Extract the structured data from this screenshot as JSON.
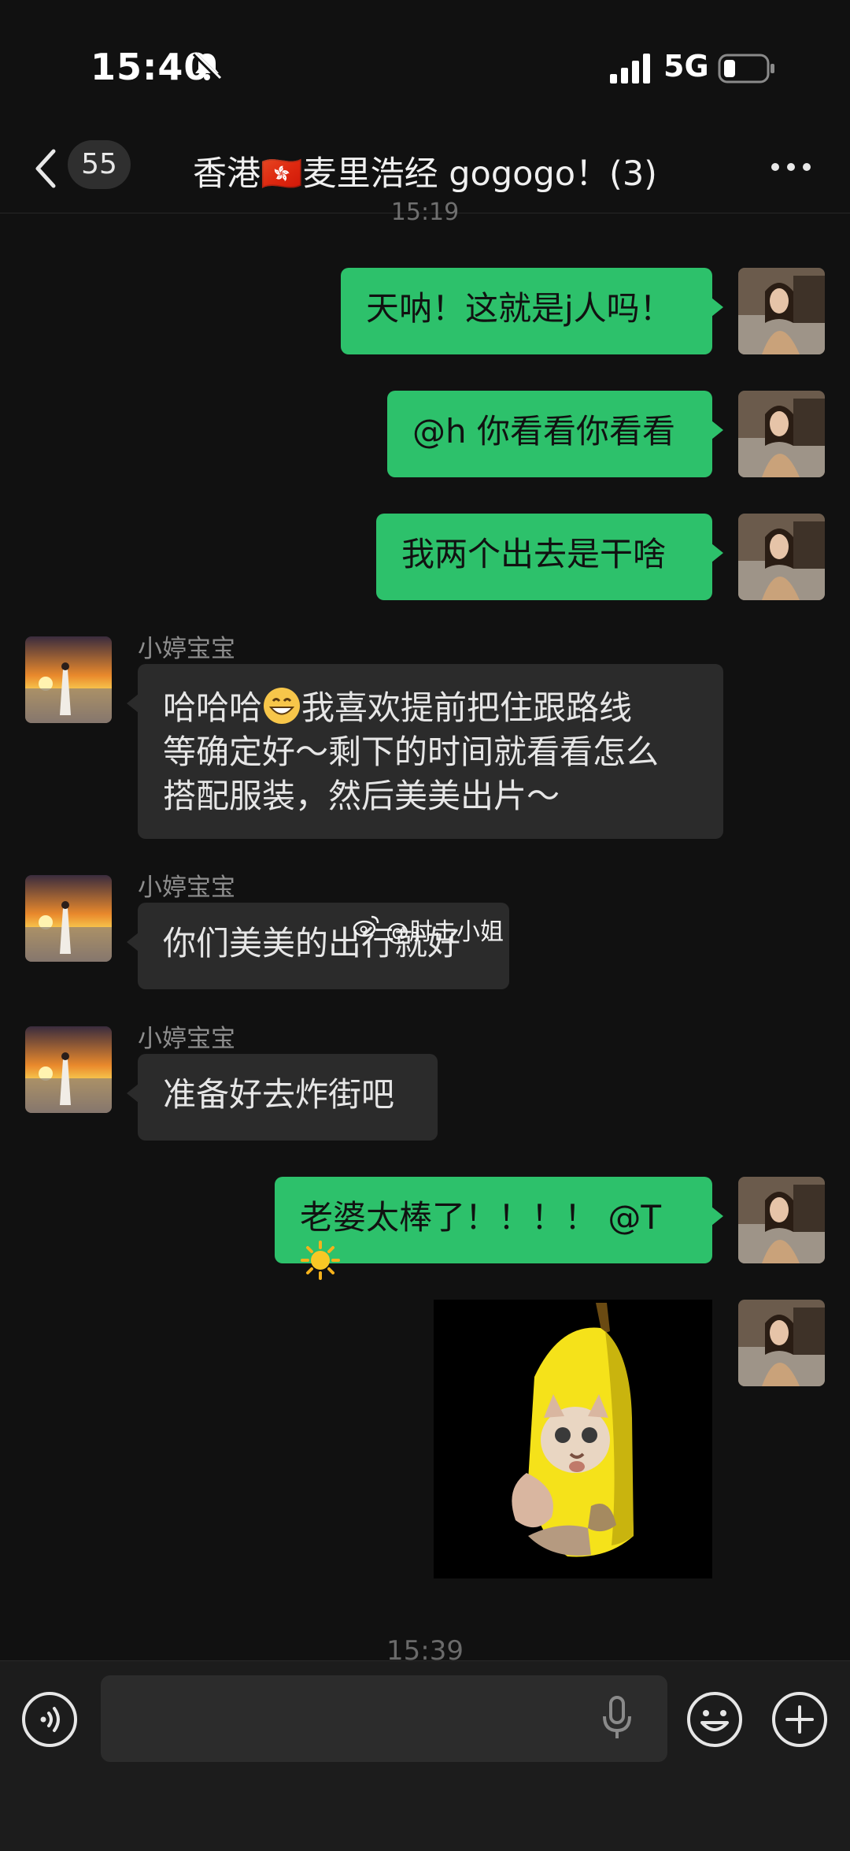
{
  "status_bar": {
    "time": "15:40",
    "network": "5G",
    "icons": [
      "mute-bell-icon",
      "signal-bars-icon",
      "battery-icon"
    ]
  },
  "header": {
    "unread_count": "55",
    "title": "香港🇭🇰麦里浩经 gogogo！(3)",
    "icons": [
      "back-chevron-icon",
      "more-dots-icon"
    ]
  },
  "timestamps": {
    "top": "15:19",
    "bottom": "15:39"
  },
  "messages": [
    {
      "from": "me",
      "text": "天呐！这就是j人吗！"
    },
    {
      "from": "me",
      "text": "@h 你看看你看看"
    },
    {
      "from": "me",
      "text": "我两个出去是干啥"
    },
    {
      "from": "other",
      "sender": "小婷宝宝",
      "lines": [
        "哈哈哈",
        "我喜欢提前把住跟路线",
        "等确定好～剩下的时间就看看怎么",
        "搭配服装，然后美美出片～"
      ]
    },
    {
      "from": "other",
      "sender": "小婷宝宝",
      "text": "你们美美的出行就好"
    },
    {
      "from": "other",
      "sender": "小婷宝宝",
      "text": "准备好去炸街吧"
    },
    {
      "from": "me",
      "text": "老婆太棒了！！！！ @T"
    },
    {
      "from": "me",
      "type": "sticker",
      "sticker": "banana-cat-sticker"
    }
  ],
  "watermark": "@肘击小姐",
  "input_bar": {
    "value": "",
    "icons": [
      "voice-icon",
      "microphone-icon",
      "emoji-icon",
      "plus-icon"
    ]
  },
  "colors": {
    "background": "#111111",
    "my_bubble": "#2dc16b",
    "other_bubble": "#2b2b2b"
  }
}
